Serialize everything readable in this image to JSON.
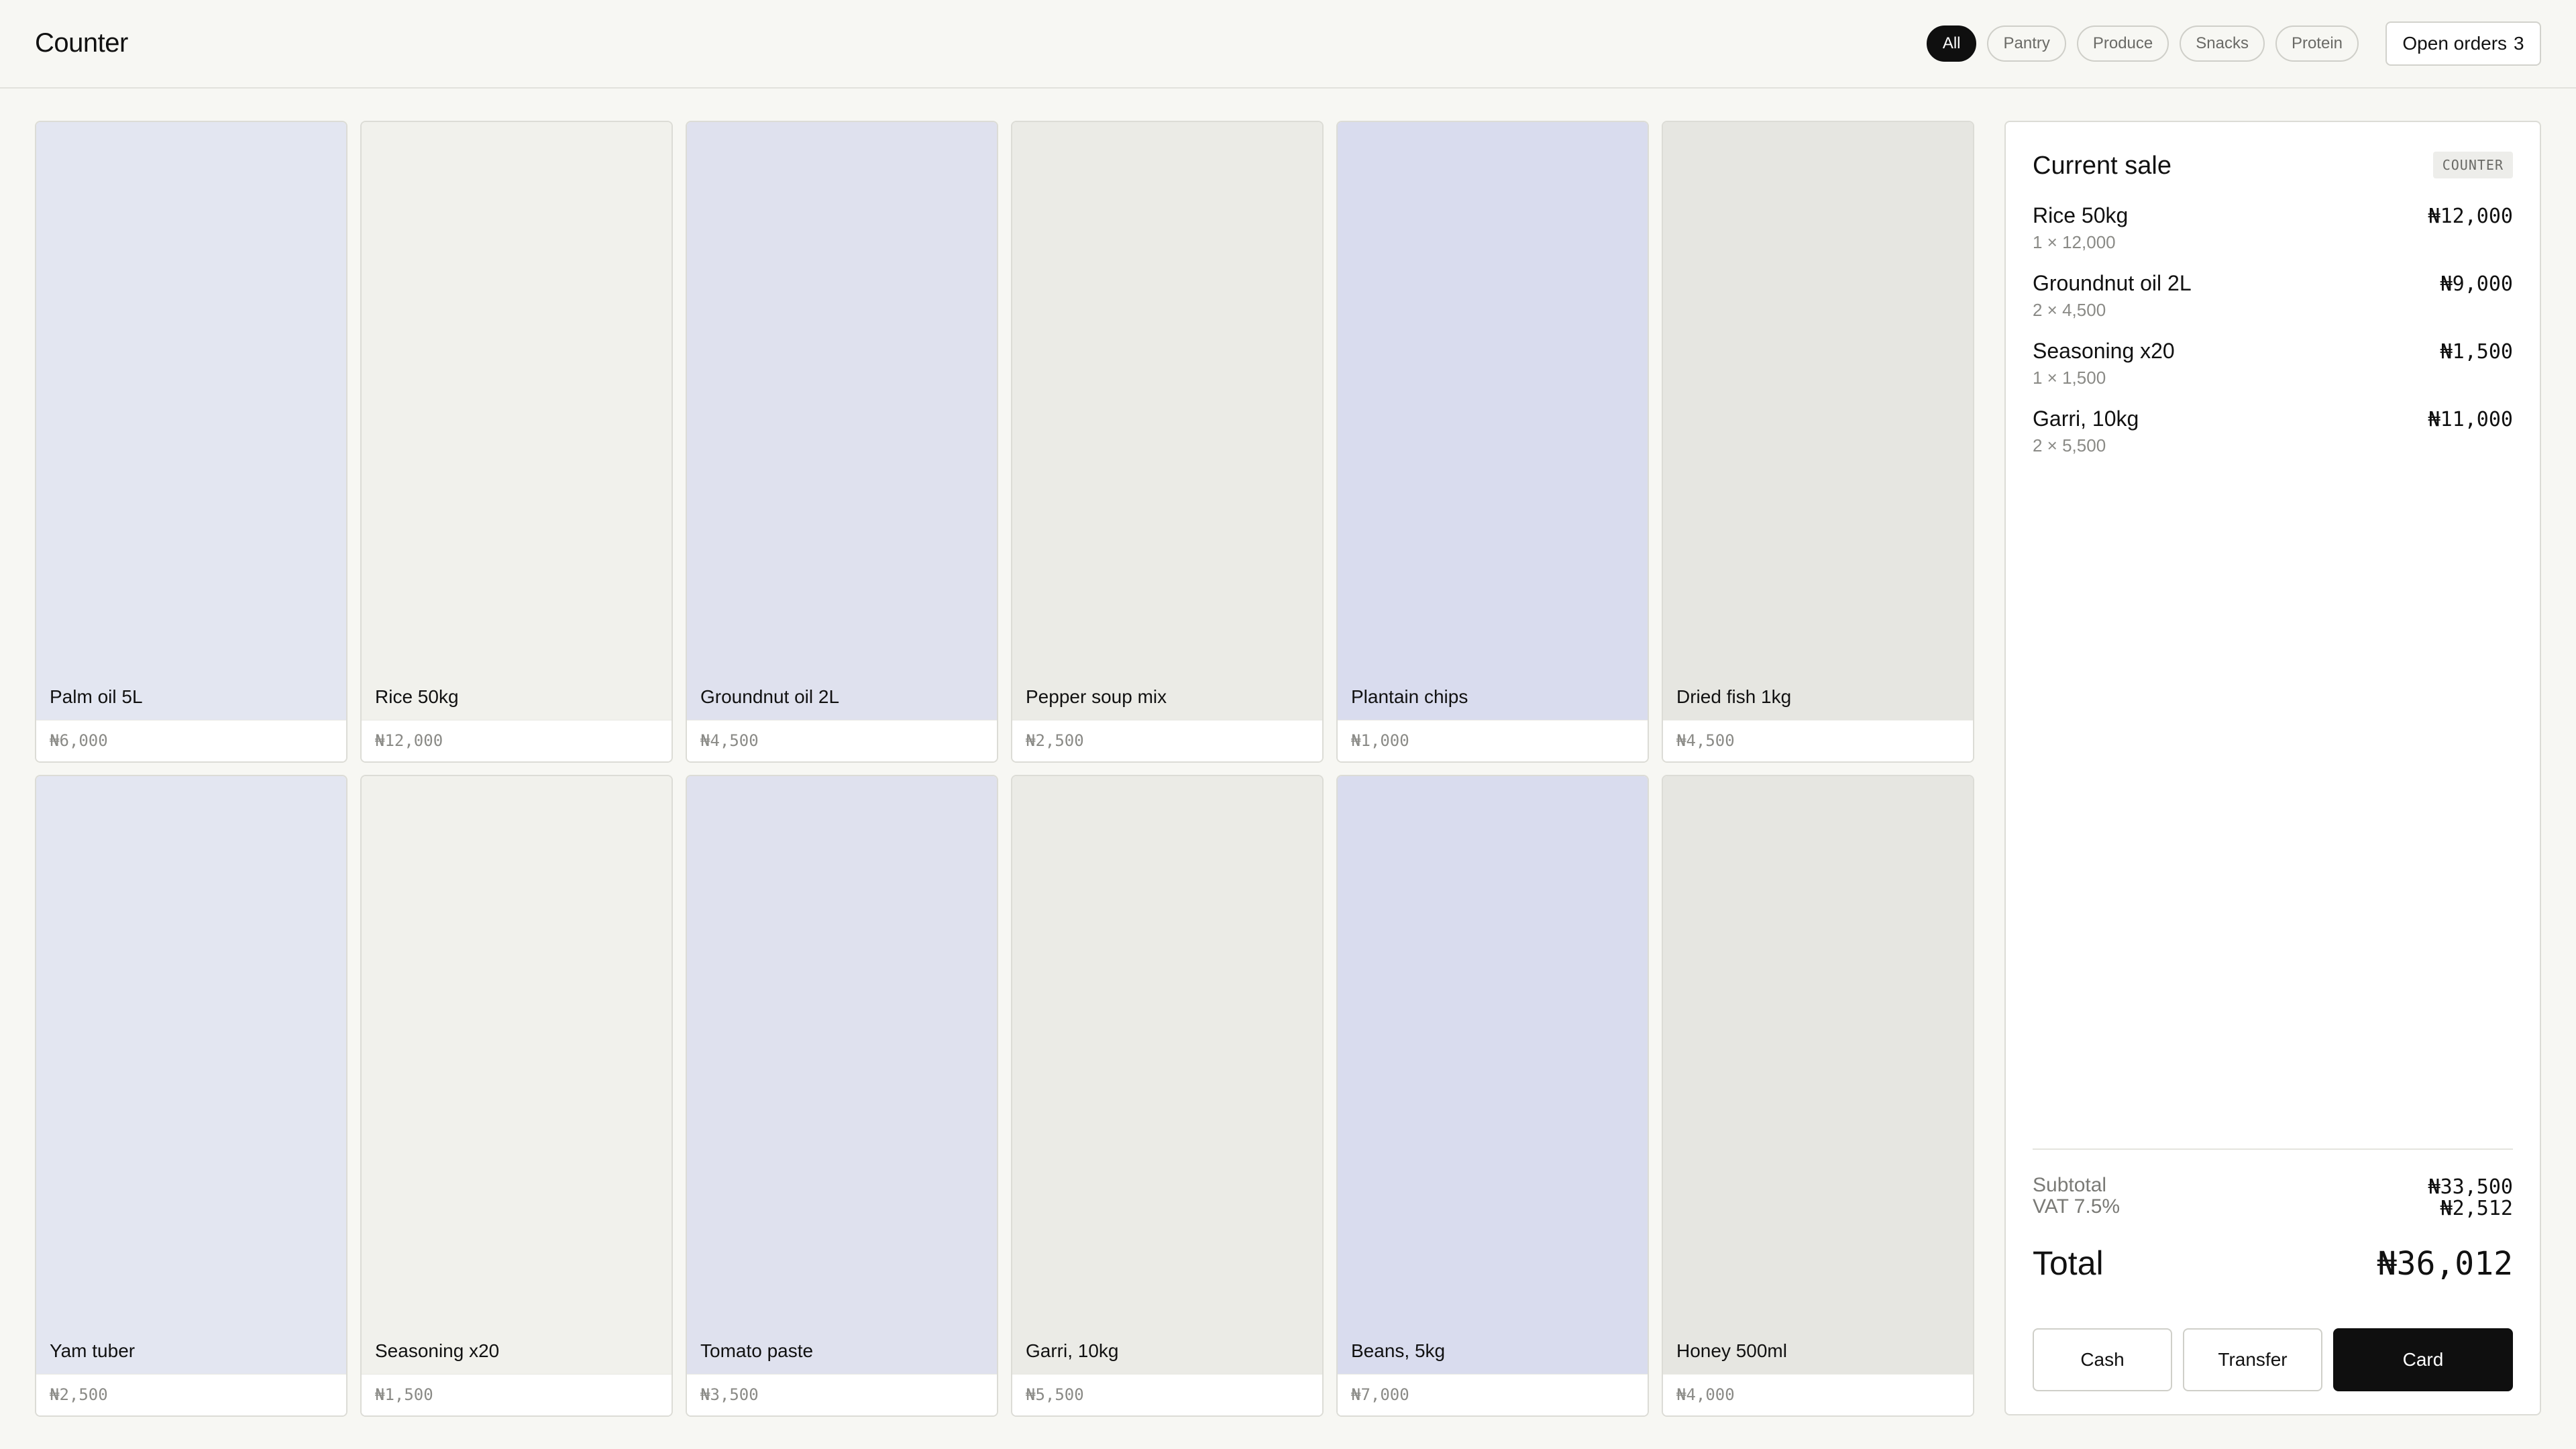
{
  "header": {
    "title": "Counter",
    "filters": [
      "All",
      "Pantry",
      "Produce",
      "Snacks",
      "Protein"
    ],
    "active_filter": "All",
    "open_orders_label": "Open orders",
    "open_orders_count": "3"
  },
  "products": [
    {
      "name": "Palm oil 5L",
      "price": "₦6,000",
      "color": "#e3e6f1"
    },
    {
      "name": "Rice 50kg",
      "price": "₦12,000",
      "color": "#f1f1ec"
    },
    {
      "name": "Groundnut oil 2L",
      "price": "₦4,500",
      "color": "#dfe1ee"
    },
    {
      "name": "Pepper soup mix",
      "price": "₦2,500",
      "color": "#ebebe6"
    },
    {
      "name": "Plantain chips",
      "price": "₦1,000",
      "color": "#d9dcee"
    },
    {
      "name": "Dried fish 1kg",
      "price": "₦4,500",
      "color": "#e6e6e1"
    },
    {
      "name": "Yam tuber",
      "price": "₦2,500",
      "color": "#e3e6f1"
    },
    {
      "name": "Seasoning x20",
      "price": "₦1,500",
      "color": "#f1f1ec"
    },
    {
      "name": "Tomato paste",
      "price": "₦3,500",
      "color": "#dfe1ee"
    },
    {
      "name": "Garri, 10kg",
      "price": "₦5,500",
      "color": "#ebebe6"
    },
    {
      "name": "Beans, 5kg",
      "price": "₦7,000",
      "color": "#d9dcee"
    },
    {
      "name": "Honey 500ml",
      "price": "₦4,000",
      "color": "#e6e6e1"
    }
  ],
  "sale": {
    "title": "Current sale",
    "badge": "COUNTER",
    "lines": [
      {
        "name": "Rice 50kg",
        "detail": "1 × 12,000",
        "amount": "₦12,000"
      },
      {
        "name": "Groundnut oil 2L",
        "detail": "2 × 4,500",
        "amount": "₦9,000"
      },
      {
        "name": "Seasoning x20",
        "detail": "1 × 1,500",
        "amount": "₦1,500"
      },
      {
        "name": "Garri, 10kg",
        "detail": "2 × 5,500",
        "amount": "₦11,000"
      }
    ],
    "subtotal_label": "Subtotal",
    "subtotal": "₦33,500",
    "vat_label": "VAT 7.5%",
    "vat": "₦2,512",
    "total_label": "Total",
    "total": "₦36,012",
    "pay": {
      "cash": "Cash",
      "transfer": "Transfer",
      "card": "Card"
    }
  },
  "colors": {
    "accent": "#0f0f0f",
    "background": "#f7f7f3",
    "muted_text": "#8a8a86"
  }
}
